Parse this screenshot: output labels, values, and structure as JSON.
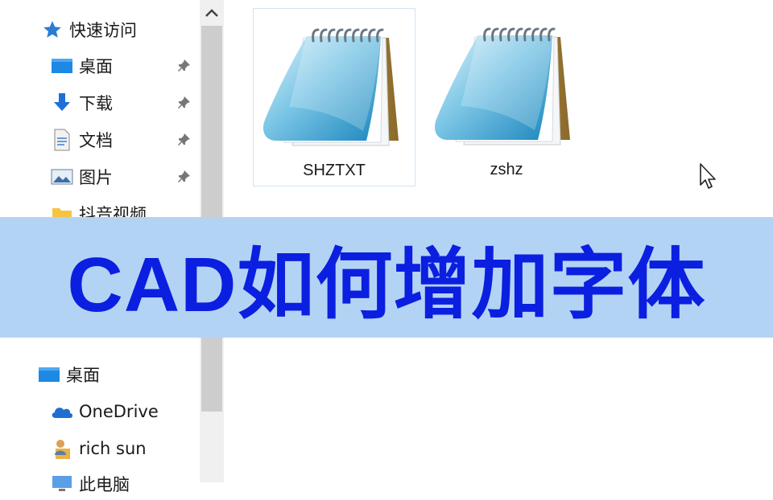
{
  "sidebar": {
    "quick_access": {
      "label": "快速访问",
      "icon": "star-icon"
    },
    "pinned_items": [
      {
        "label": "桌面",
        "icon": "desktop-folder-icon",
        "pinned": true
      },
      {
        "label": "下载",
        "icon": "download-arrow-icon",
        "pinned": true
      },
      {
        "label": "文档",
        "icon": "document-folder-icon",
        "pinned": true
      },
      {
        "label": "图片",
        "icon": "pictures-folder-icon",
        "pinned": true
      },
      {
        "label": "抖音视频",
        "icon": "folder-icon",
        "pinned": false
      }
    ],
    "root_items": [
      {
        "label": "桌面",
        "icon": "desktop-folder-icon"
      },
      {
        "label": "OneDrive",
        "icon": "onedrive-cloud-icon"
      },
      {
        "label": "rich sun",
        "icon": "user-folder-icon"
      },
      {
        "label": "此电脑",
        "icon": "computer-icon"
      }
    ]
  },
  "files": [
    {
      "name": "SHZTXT",
      "icon": "notepad-icon",
      "selected": true
    },
    {
      "name": "zshz",
      "icon": "notepad-icon",
      "selected": false
    }
  ],
  "banner": {
    "text": "CAD如何增加字体",
    "color": "#0b1fe0",
    "background": "#b3d3f5"
  },
  "colors": {
    "selection_border": "#cfe3f5",
    "scrollbar_thumb": "#cdcdcd"
  }
}
